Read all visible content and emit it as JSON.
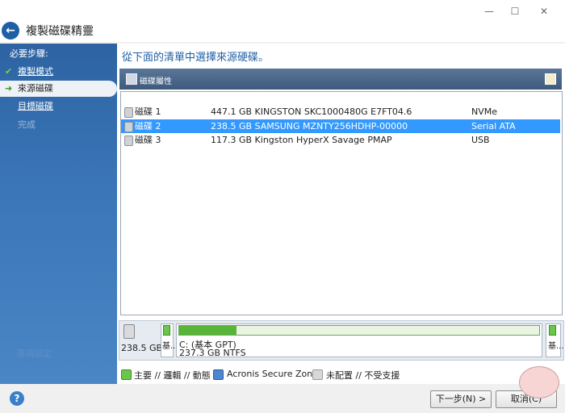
{
  "window": {
    "title": "複製磁碟精靈",
    "controls": {
      "minimize": "—",
      "maximize": "☐",
      "close": "✕"
    }
  },
  "sidebar": {
    "heading": "必要步驟:",
    "items": [
      {
        "label": "複製模式",
        "state": "done",
        "icon": "checkmark-icon"
      },
      {
        "label": "來源磁碟",
        "state": "active",
        "icon": "arrow-right-icon"
      },
      {
        "label": "目標磁碟",
        "state": "link"
      },
      {
        "label": "完成",
        "state": "disabled"
      }
    ],
    "faded_label": "選項設定"
  },
  "main": {
    "instruction": "從下面的清單中選擇來源硬碟。",
    "toolbar": {
      "label": "磁碟屬性"
    },
    "disks": [
      {
        "name": "磁碟 1",
        "desc": "447.1 GB KINGSTON SKC1000480G E7FT04.6",
        "iface": "NVMe",
        "selected": false
      },
      {
        "name": "磁碟 2",
        "desc": "238.5 GB SAMSUNG MZNTY256HDHP-00000",
        "iface": "Serial ATA",
        "selected": true
      },
      {
        "name": "磁碟 3",
        "desc": "117.3 GB Kingston HyperX Savage PMAP",
        "iface": "USB",
        "selected": false
      }
    ],
    "partition_panel": {
      "disk_size": "238.5 GB",
      "small_seg_label": "基...",
      "main_seg_line1": "C: (基本 GPT)",
      "main_seg_line2": "237.3 GB  NTFS",
      "used_fraction": 0.16,
      "end_seg_label": "基..."
    },
    "legend": [
      {
        "label": "主要 // 邏輯 // 動態",
        "color": "#6bc64c"
      },
      {
        "label": "Acronis Secure Zone",
        "color": "#4f86d0"
      },
      {
        "label": "未配置 // 不受支援",
        "color": "#d8d8d8"
      }
    ]
  },
  "footer": {
    "help_label": "?",
    "next_label": "下一步(N) >",
    "cancel_label": "取消(C)"
  },
  "colors": {
    "accent": "#1f5fa6",
    "selection": "#3399ff",
    "sidebar": "#3a75b7"
  }
}
